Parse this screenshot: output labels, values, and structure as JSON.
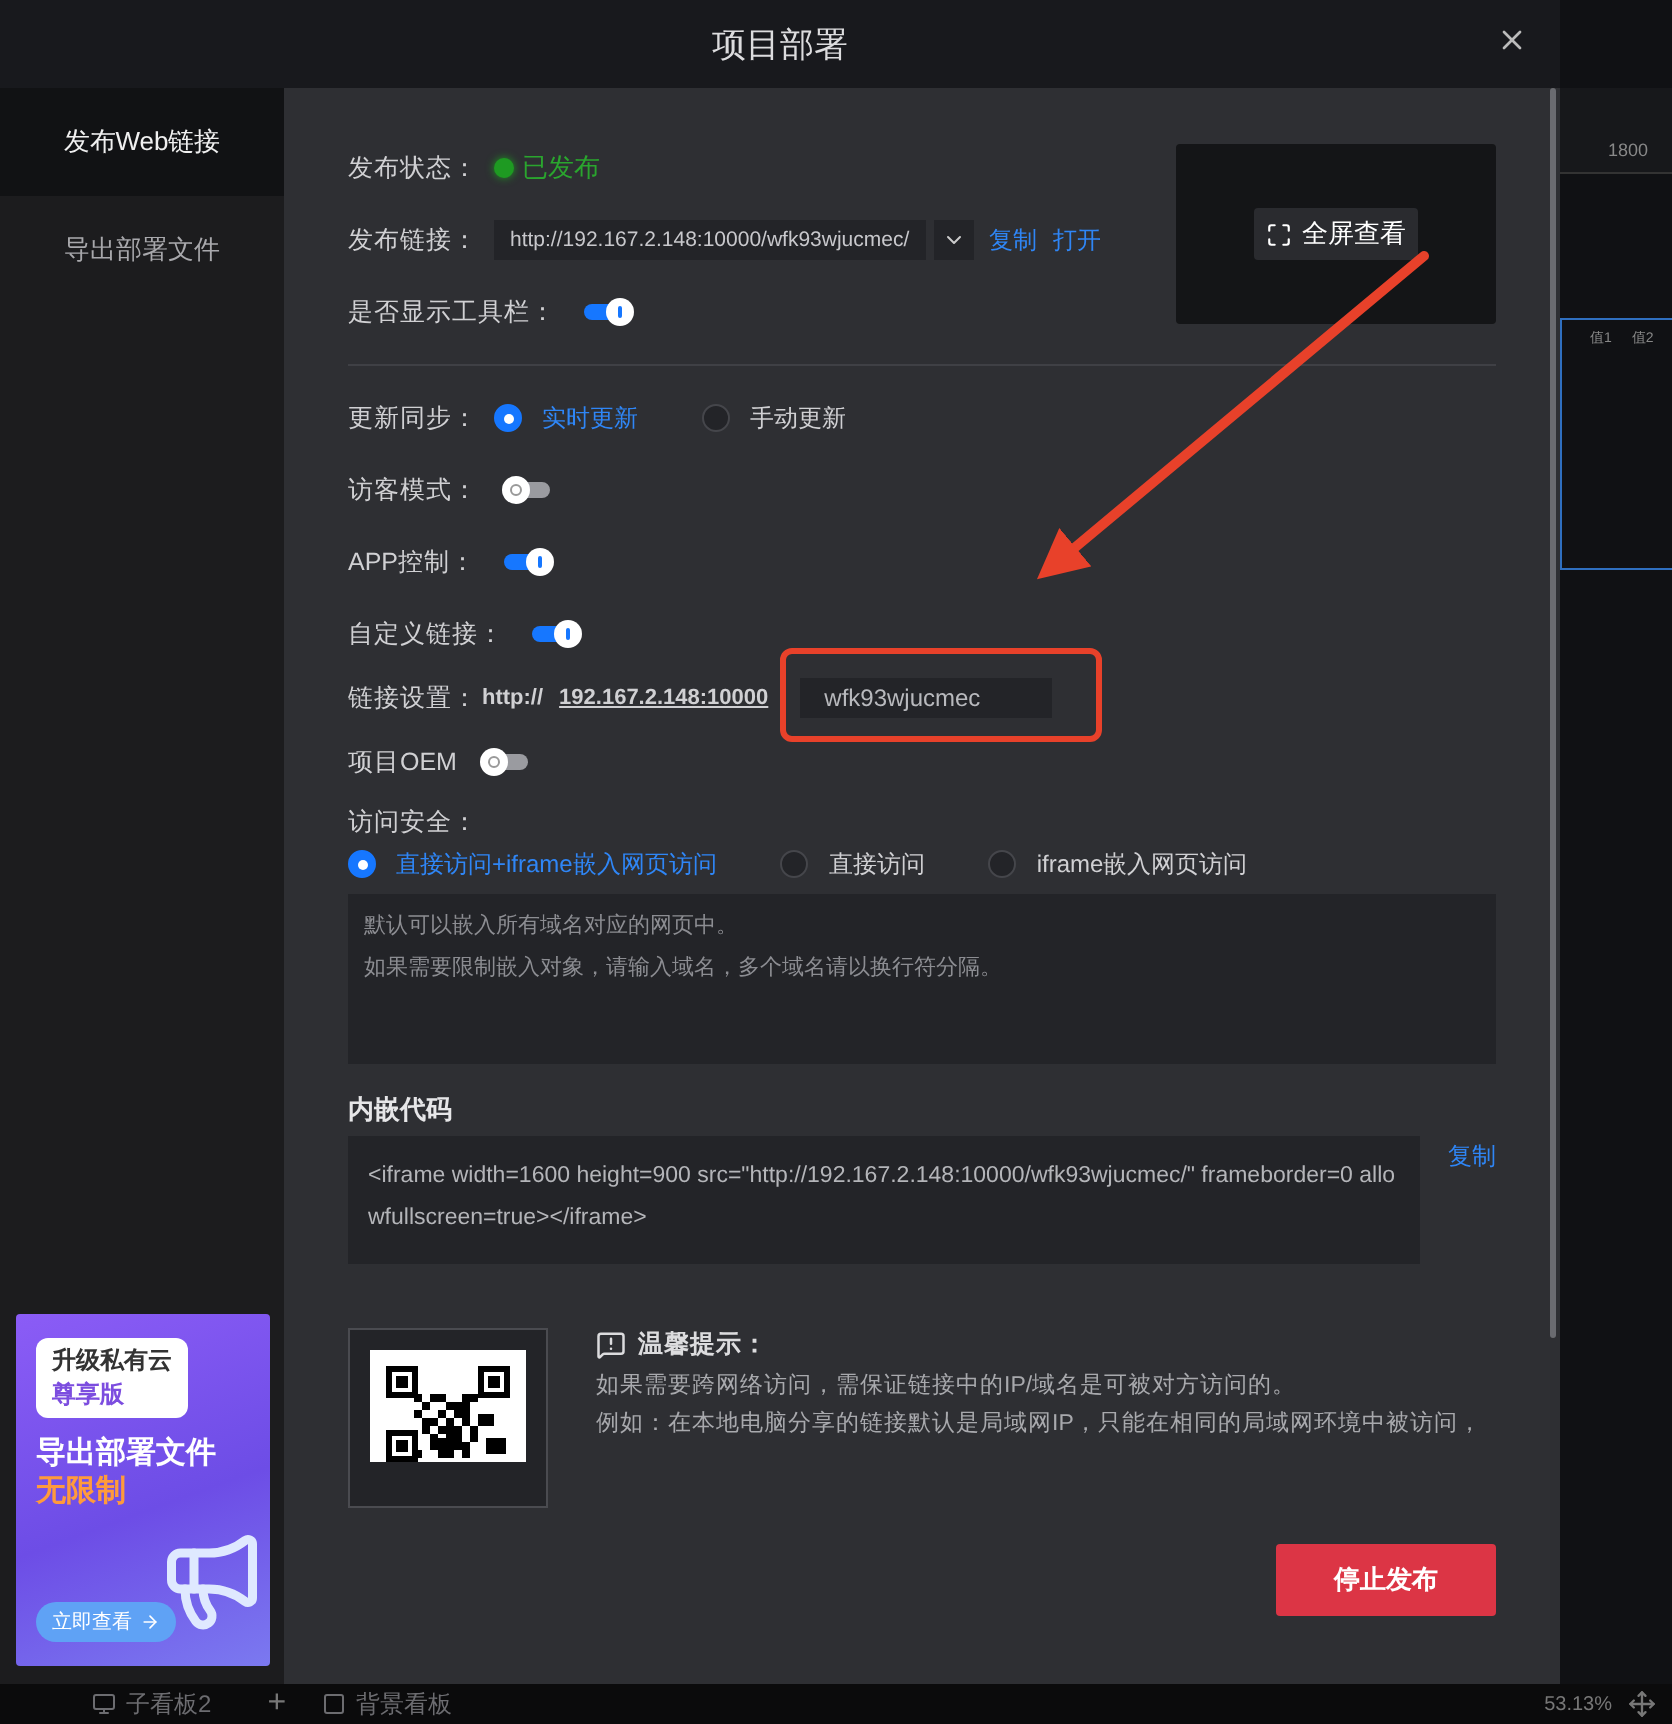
{
  "dialog": {
    "title": "项目部署"
  },
  "sidebar": {
    "items": [
      {
        "label": "发布Web链接",
        "selected": true
      },
      {
        "label": "导出部署文件",
        "selected": false
      }
    ]
  },
  "promo": {
    "badge_line1": "升级私有云",
    "badge_line2": "尊享版",
    "headline": "导出部署文件",
    "highlight": "无限制",
    "button": "立即查看"
  },
  "publish": {
    "status_label": "发布状态：",
    "status": "已发布",
    "published": true,
    "link_label": "发布链接：",
    "link": "http://192.167.2.148:10000/wfk93wjucmec/",
    "copy": "复制",
    "open": "打开",
    "toolbar_label": "是否显示工具栏：",
    "toolbar_on": true
  },
  "preview": {
    "button": "全屏查看"
  },
  "settings": [
    {
      "kind": "radio",
      "label": "更新同步：",
      "options": [
        {
          "label": "实时更新",
          "selected": true
        },
        {
          "label": "手动更新",
          "selected": false
        }
      ]
    },
    {
      "kind": "toggle",
      "label": "访客模式：",
      "on": false
    },
    {
      "kind": "toggle",
      "label": "APP控制：",
      "on": true
    },
    {
      "kind": "toggle",
      "label": "自定义链接：",
      "on": true
    },
    {
      "kind": "link",
      "label": "链接设置：",
      "prefix": "http://",
      "host": "192.167.2.148:10000",
      "path": "wfk93wjucmec"
    },
    {
      "kind": "toggle",
      "label": "项目OEM",
      "on": false
    }
  ],
  "security": {
    "label": "访问安全：",
    "options": [
      {
        "label": "直接访问+iframe嵌入网页访问",
        "selected": true
      },
      {
        "label": "直接访问",
        "selected": false
      },
      {
        "label": "iframe嵌入网页访问",
        "selected": false
      }
    ],
    "placeholder": [
      "默认可以嵌入所有域名对应的网页中。",
      "如果需要限制嵌入对象，请输入域名，多个域名请以换行符分隔。"
    ]
  },
  "embed": {
    "title": "内嵌代码",
    "code": "<iframe width=1600 height=900 src=\"http://192.167.2.148:10000/wfk93wjucmec/\" frameborder=0 allowfullscreen=true></iframe>",
    "copy": "复制"
  },
  "tips": {
    "title": "温馨提示：",
    "lines": [
      "如果需要跨网络访问，需保证链接中的IP/域名是可被对方访问的。",
      "例如：在本地电脑分享的链接默认是局域网IP，只能在相同的局域网环境中被访问，"
    ]
  },
  "footer": {
    "stop_button": "停止发布"
  },
  "background": {
    "ruler_label": "1800",
    "legend": [
      "值1",
      "值2"
    ],
    "tabs": [
      "子看板2",
      "背景看板"
    ],
    "add": "+",
    "zoom": "53.13%"
  }
}
